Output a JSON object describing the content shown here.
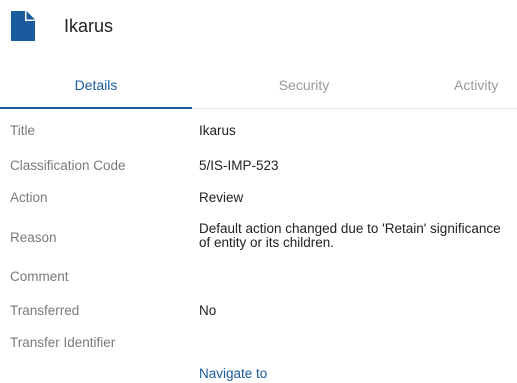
{
  "header": {
    "title": "Ikarus",
    "icon": "document-icon",
    "accent_color": "#1a5a9e"
  },
  "tabs": [
    {
      "label": "Details",
      "active": true
    },
    {
      "label": "Security",
      "active": false
    },
    {
      "label": "Activity",
      "active": false
    }
  ],
  "details": {
    "title_label": "Title",
    "title_value": "Ikarus",
    "classification_label": "Classification Code",
    "classification_value": "5/IS-IMP-523",
    "action_label": "Action",
    "action_value": "Review",
    "reason_label": "Reason",
    "reason_value": "Default action changed due to 'Retain' significance of entity or its children.",
    "comment_label": "Comment",
    "comment_value": "",
    "transferred_label": "Transferred",
    "transferred_value": "No",
    "transfer_identifier_label": "Transfer Identifier",
    "transfer_identifier_value": ""
  },
  "navigate_link": "Navigate to"
}
